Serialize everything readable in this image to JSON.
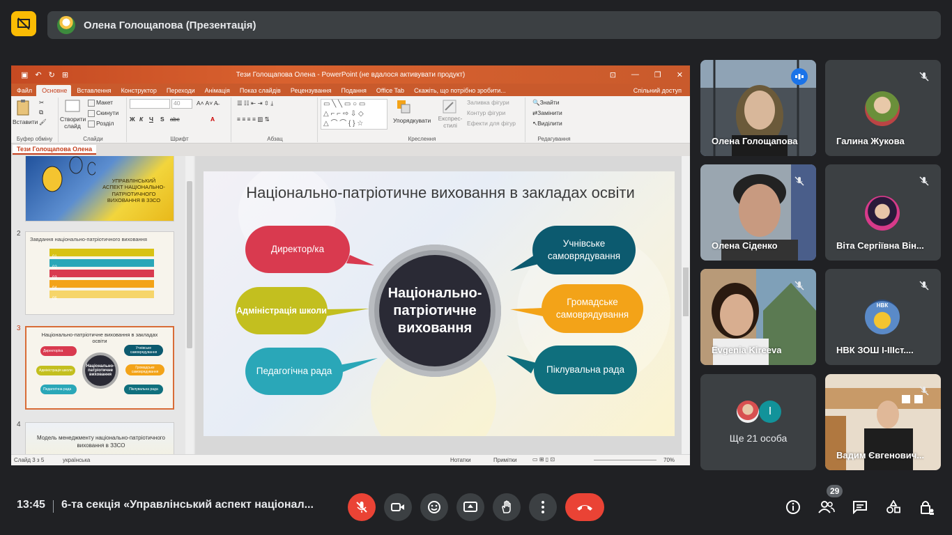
{
  "meeting": {
    "presenter_label": "Олена Голощапова (Презентація)",
    "time": "13:45",
    "title": "6-та секція «Управлінський аспект націонал...",
    "participants_count": "29"
  },
  "powerpoint": {
    "window_title": "Тези Голощапова Олена - PowerPoint (не вдалося активувати продукт)",
    "tabs": [
      "Файл",
      "Основне",
      "Вставлення",
      "Конструктор",
      "Переходи",
      "Анімація",
      "Показ слайдів",
      "Рецензування",
      "Подання",
      "Office Tab",
      "Скажіть, що потрібно зробити..."
    ],
    "selected_tab": "Основне",
    "share_label": "Спільний доступ",
    "ribbon": {
      "paste": "Вставити",
      "new_slide": "Створити слайд",
      "layout": "Макет",
      "reset": "Скинути",
      "section": "Розділ",
      "font_size": "40",
      "font_bold": "Ж",
      "font_italic": "К",
      "font_underline": "Ч",
      "font_shadow": "S",
      "font_strike": "abc",
      "font_color": "A",
      "arrange": "Упорядкувати",
      "quick_styles": "Експрес-стилі",
      "shape_fill": "Заливка фігури",
      "shape_outline": "Контур фігури",
      "shape_effects": "Ефекти для фігур",
      "find": "Знайти",
      "replace": "Замінити",
      "select": "Виділити",
      "groups": [
        "Буфер обміну",
        "Слайди",
        "Шрифт",
        "Абзац",
        "Креслення",
        "Редагування"
      ]
    },
    "doc_tab": "Тези Голощапова Олена",
    "thumbnails": [
      {
        "num": "",
        "text": "УПРАВЛІНСЬКИЙ АСПЕКТ НАЦІОНАЛЬНО-ПАТРІОТИЧНОГО ВИХОВАННЯ В ЗЗСО"
      },
      {
        "num": "2",
        "text": "Завдання національно-патріотичного виховання",
        "rows": [
          "01",
          "02",
          "03",
          "04",
          "05"
        ]
      },
      {
        "num": "3",
        "text": "Національно-патріотичне виховання в закладах освіти",
        "center": "Національно-патріотичне виховання",
        "bubbles": [
          "Директор/ка",
          "Адміністрація школи",
          "Педагогічна рада",
          "Учнівське самоврядування",
          "Громадське самоврядування",
          "Піклувальна рада"
        ]
      },
      {
        "num": "4",
        "text": "Модель менеджменту національно-патріотичного виховання в ЗЗСО"
      }
    ],
    "status": {
      "slide_of": "Слайд 3 з 5",
      "language": "українська",
      "notes": "Нотатки",
      "comments": "Примітки",
      "zoom": "70%"
    }
  },
  "slide": {
    "title": "Національно-патріотичне виховання в закладах освіти",
    "center": "Національно-патріотичне виховання",
    "left_bubbles": [
      "Директор/ка",
      "Адміністрація школи",
      "Педагогічна рада"
    ],
    "right_bubbles": [
      "Учнівське самоврядування",
      "Громадське самоврядування",
      "Піклувальна рада"
    ],
    "colors": {
      "red": "#d93a4f",
      "olive": "#c3bf1f",
      "teal": "#2aa7b8",
      "navy": "#0c5a6f",
      "orange": "#f3a318",
      "dark_teal": "#0f6f7d",
      "center": "#2a2a35"
    }
  },
  "participants": [
    {
      "name": "Олена Голощапова",
      "speaking": true
    },
    {
      "name": "Галина Жукова",
      "muted": true
    },
    {
      "name": "Олена Сіденко",
      "muted": true
    },
    {
      "name": "Віта Сергіївна Він...",
      "muted": true
    },
    {
      "name": "Evgenia Kireeva",
      "muted": true
    },
    {
      "name": "НВК ЗОШ І-ІІІст....",
      "muted": true,
      "avatar_text": "НВК"
    },
    {
      "name": "Ще 21 особа",
      "avatar_letter": "I"
    },
    {
      "name": "Вадим Євгенович...",
      "muted": true
    }
  ],
  "colors": {
    "background": "#202124",
    "tile": "#3c4043",
    "end_call": "#ea4335",
    "mute_active": "#ea4335",
    "highlight": "#8ab4f8",
    "ppt_orange": "#c54a22"
  }
}
